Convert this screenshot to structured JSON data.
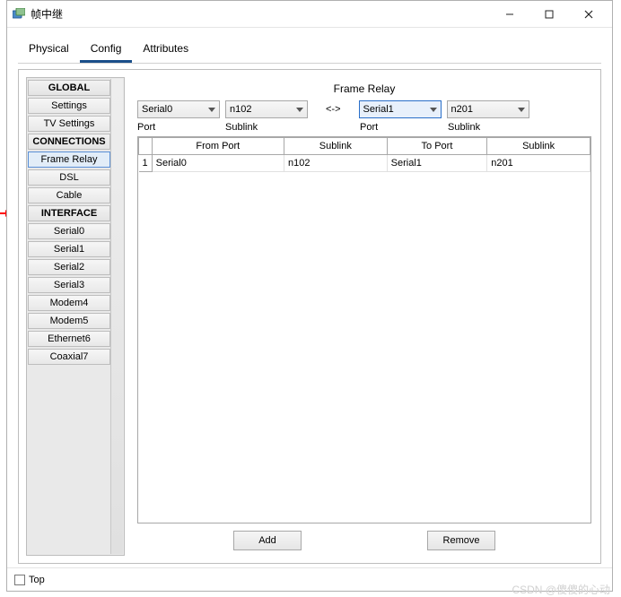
{
  "window": {
    "title": "帧中继"
  },
  "tabs": {
    "physical": "Physical",
    "config": "Config",
    "attributes": "Attributes"
  },
  "sidebar": {
    "h_global": "GLOBAL",
    "settings": "Settings",
    "tv_settings": "TV Settings",
    "h_connections": "CONNECTIONS",
    "frame_relay": "Frame Relay",
    "dsl": "DSL",
    "cable": "Cable",
    "h_interface": "INTERFACE",
    "serial0": "Serial0",
    "serial1": "Serial1",
    "serial2": "Serial2",
    "serial3": "Serial3",
    "modem4": "Modem4",
    "modem5": "Modem5",
    "ethernet6": "Ethernet6",
    "coaxial7": "Coaxial7"
  },
  "main": {
    "title": "Frame Relay",
    "left_port": "Serial0",
    "left_sublink": "n102",
    "arrow": "<->",
    "right_port": "Serial1",
    "right_sublink": "n201",
    "port_lbl": "Port",
    "sublink_lbl": "Sublink"
  },
  "table": {
    "cols": {
      "from_port": "From Port",
      "sublink1": "Sublink",
      "to_port": "To Port",
      "sublink2": "Sublink"
    },
    "rows": [
      {
        "n": "1",
        "from_port": "Serial0",
        "sublink1": "n102",
        "to_port": "Serial1",
        "sublink2": "n201"
      }
    ]
  },
  "buttons": {
    "add": "Add",
    "remove": "Remove"
  },
  "footer": {
    "top": "Top"
  },
  "watermark": "CSDN @傻傻的心动"
}
